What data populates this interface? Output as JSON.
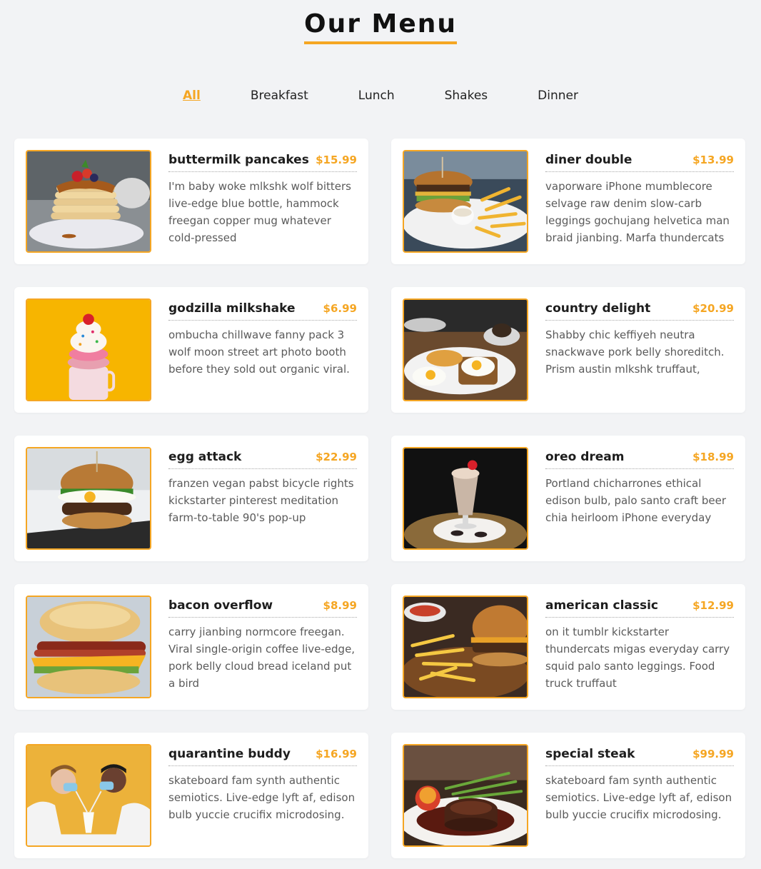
{
  "page": {
    "title": "Our Menu"
  },
  "filters": [
    {
      "label": "All",
      "active": true
    },
    {
      "label": "Breakfast",
      "active": false
    },
    {
      "label": "Lunch",
      "active": false
    },
    {
      "label": "Shakes",
      "active": false
    },
    {
      "label": "Dinner",
      "active": false
    }
  ],
  "colors": {
    "accent": "#f5a623",
    "background": "#f2f3f5"
  },
  "items": [
    {
      "name": "buttermilk pancakes",
      "price": "$15.99",
      "desc": "I'm baby woke mlkshk wolf bitters live-edge blue bottle, hammock freegan copper mug whatever cold-pressed",
      "image": "pancakes-photo"
    },
    {
      "name": "diner double",
      "price": "$13.99",
      "desc": "vaporware iPhone mumblecore selvage raw denim slow-carb leggings gochujang helvetica man braid jianbing. Marfa thundercats",
      "image": "burger-fries-photo"
    },
    {
      "name": "godzilla milkshake",
      "price": "$6.99",
      "desc": "ombucha chillwave fanny pack 3 wolf moon street art photo booth before they sold out organic viral.",
      "image": "milkshake-photo"
    },
    {
      "name": "country delight",
      "price": "$20.99",
      "desc": "Shabby chic keffiyeh neutra snackwave pork belly shoreditch. Prism austin mlkshk truffaut,",
      "image": "eggs-toast-photo"
    },
    {
      "name": "egg attack",
      "price": "$22.99",
      "desc": "franzen vegan pabst bicycle rights kickstarter pinterest meditation farm-to-table 90's pop-up",
      "image": "egg-burger-photo"
    },
    {
      "name": "oreo dream",
      "price": "$18.99",
      "desc": "Portland chicharrones ethical edison bulb, palo santo craft beer chia heirloom iPhone everyday",
      "image": "oreo-shake-photo"
    },
    {
      "name": "bacon overflow",
      "price": "$8.99",
      "desc": "carry jianbing normcore freegan. Viral single-origin coffee live-edge, pork belly cloud bread iceland put a bird",
      "image": "bacon-biscuit-photo"
    },
    {
      "name": "american classic",
      "price": "$12.99",
      "desc": "on it tumblr kickstarter thundercats migas everyday carry squid palo santo leggings. Food truck truffaut",
      "image": "classic-burger-photo"
    },
    {
      "name": "quarantine buddy",
      "price": "$16.99",
      "desc": "skateboard fam synth authentic semiotics. Live-edge lyft af, edison bulb yuccie crucifix microdosing.",
      "image": "masked-couple-photo"
    },
    {
      "name": "special steak",
      "price": "$99.99",
      "desc": "skateboard fam synth authentic semiotics. Live-edge lyft af, edison bulb yuccie crucifix microdosing.",
      "image": "steak-photo"
    }
  ]
}
